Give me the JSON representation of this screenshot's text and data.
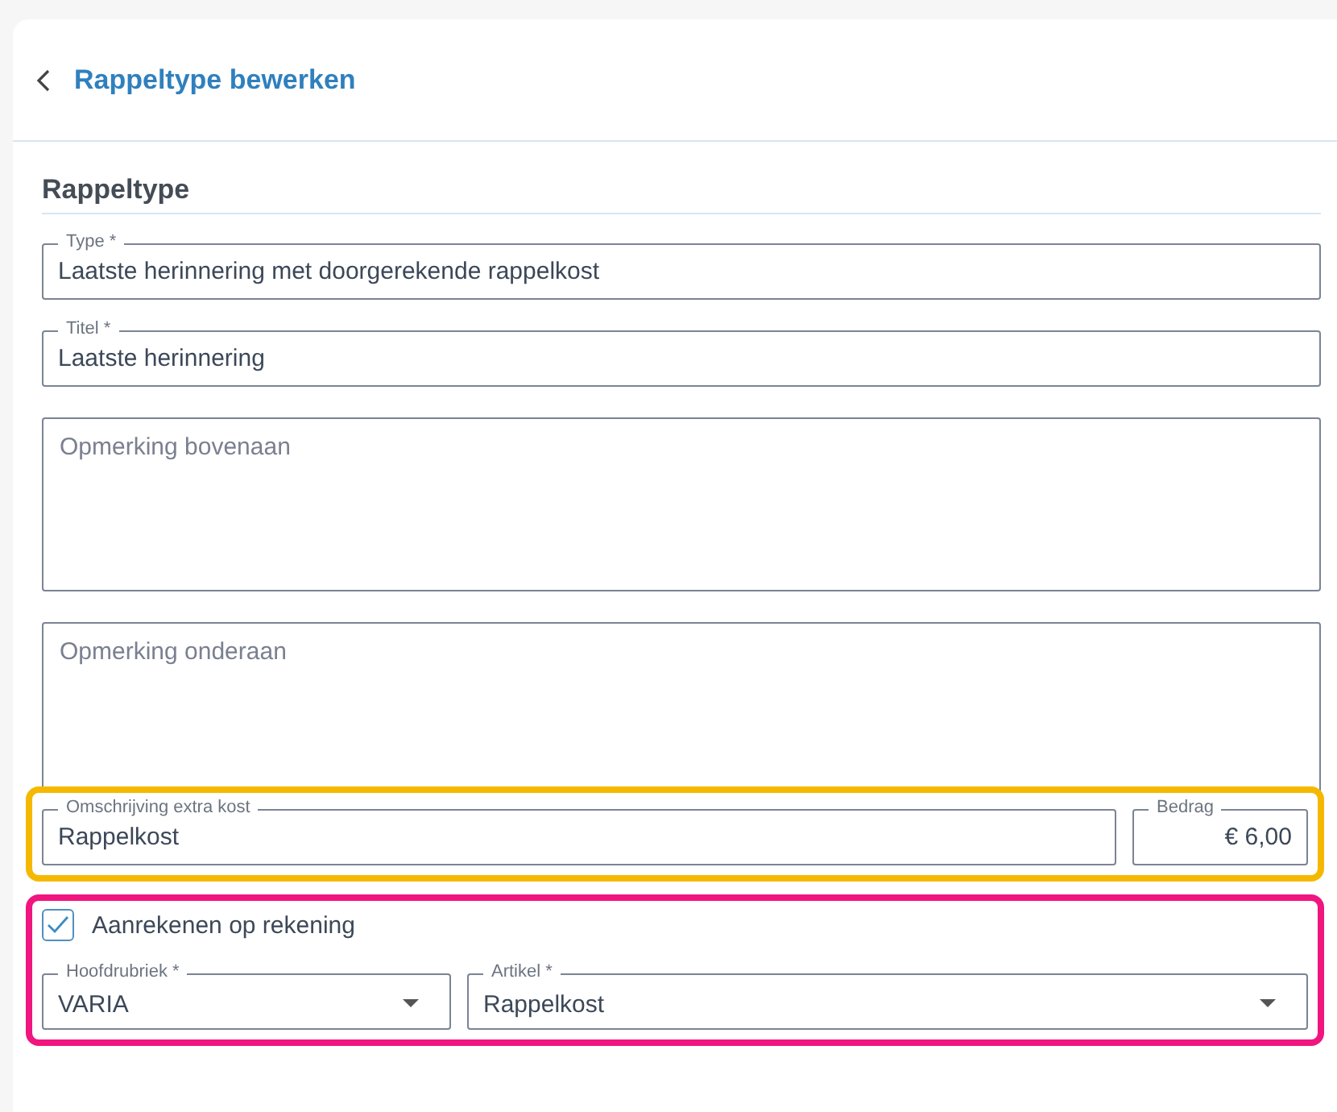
{
  "header": {
    "title": "Rappeltype bewerken"
  },
  "section": {
    "title": "Rappeltype"
  },
  "fields": [
    {
      "kind": "text",
      "label": "Type *",
      "value": "Laatste herinnering met doorgerekende rappelkost"
    },
    {
      "kind": "text",
      "label": "Titel *",
      "value": "Laatste herinnering"
    },
    {
      "kind": "textarea",
      "placeholder": "Opmerking bovenaan"
    },
    {
      "kind": "textarea",
      "placeholder": "Opmerking onderaan"
    }
  ],
  "highlights": [
    {
      "color": "#f5b800",
      "rows": [
        [
          {
            "kind": "text",
            "label": "Omschrijving extra kost",
            "value": "Rappelkost"
          },
          {
            "kind": "amount",
            "label": "Bedrag",
            "value": "€ 6,00"
          }
        ]
      ]
    },
    {
      "color": "#f0157f",
      "rows": [
        [
          {
            "kind": "checkbox",
            "label": "Aanrekenen op rekening",
            "checked": true
          }
        ],
        [
          {
            "kind": "select",
            "label": "Hoofdrubriek *",
            "value": "VARIA"
          },
          {
            "kind": "select",
            "label": "Artikel *",
            "value": "Rappelkost"
          }
        ]
      ]
    }
  ]
}
